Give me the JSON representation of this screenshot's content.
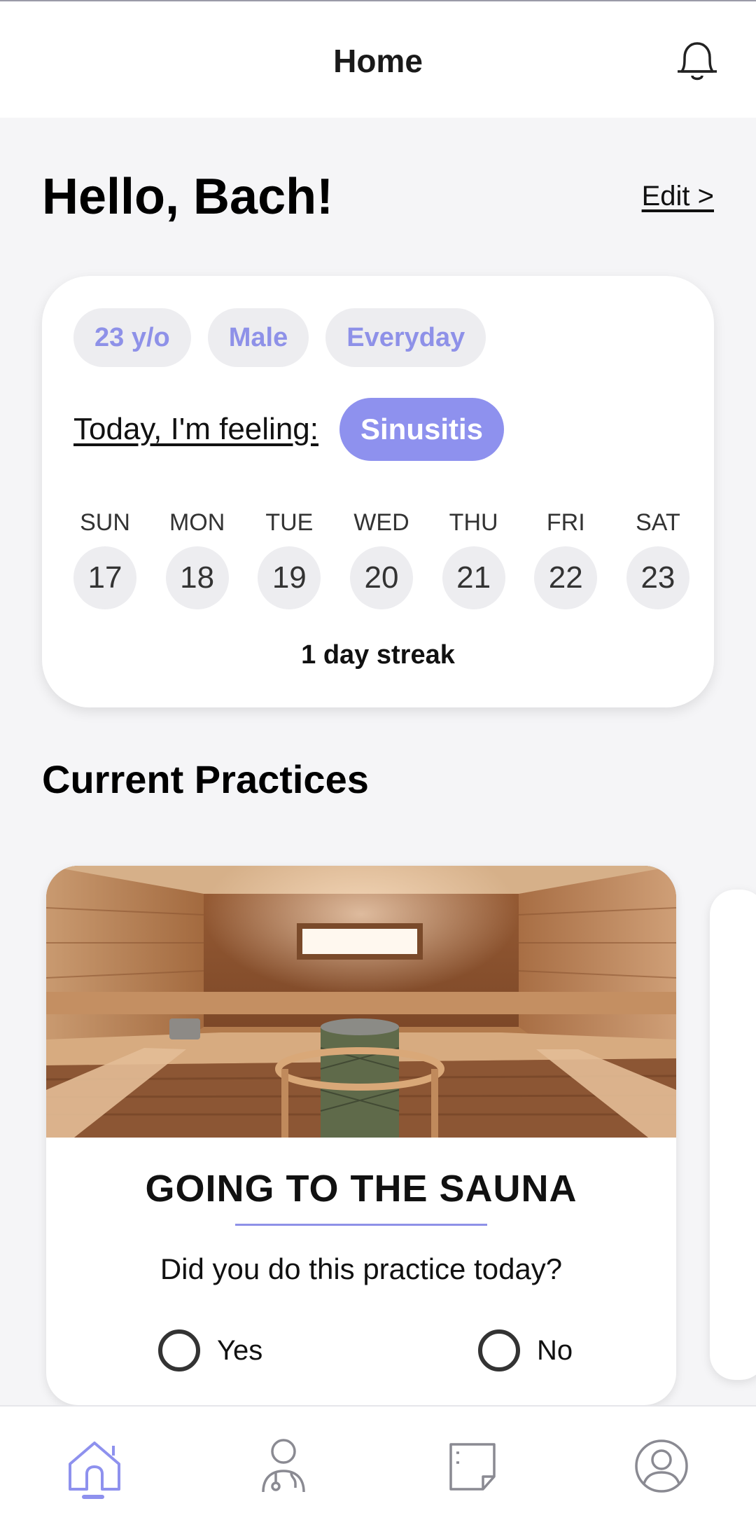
{
  "header": {
    "title": "Home",
    "notification_icon": "bell-icon"
  },
  "greeting": {
    "text": "Hello, Bach!",
    "edit_label": "Edit >"
  },
  "profile": {
    "tags": [
      "23 y/o",
      "Male",
      "Everyday"
    ],
    "feeling_label": "Today, I'm feeling:",
    "feeling_value": "Sinusitis",
    "week": [
      {
        "day": "SUN",
        "date": "17"
      },
      {
        "day": "MON",
        "date": "18"
      },
      {
        "day": "TUE",
        "date": "19"
      },
      {
        "day": "WED",
        "date": "20"
      },
      {
        "day": "THU",
        "date": "21"
      },
      {
        "day": "FRI",
        "date": "22"
      },
      {
        "day": "SAT",
        "date": "23"
      }
    ],
    "streak": "1 day streak"
  },
  "practices": {
    "section_title": "Current Practices",
    "items": [
      {
        "title": "GOING TO THE SAUNA",
        "question": "Did you do this practice today?",
        "options": [
          "Yes",
          "No"
        ]
      }
    ]
  },
  "bottom_nav": {
    "items": [
      {
        "name": "home",
        "icon": "home-icon",
        "active": true
      },
      {
        "name": "practitioner",
        "icon": "doctor-icon",
        "active": false
      },
      {
        "name": "notes",
        "icon": "note-icon",
        "active": false
      },
      {
        "name": "profile",
        "icon": "profile-icon",
        "active": false
      }
    ]
  },
  "colors": {
    "accent": "#8e91ee",
    "tag_bg": "#ededf0",
    "page_bg": "#f5f5f7"
  }
}
